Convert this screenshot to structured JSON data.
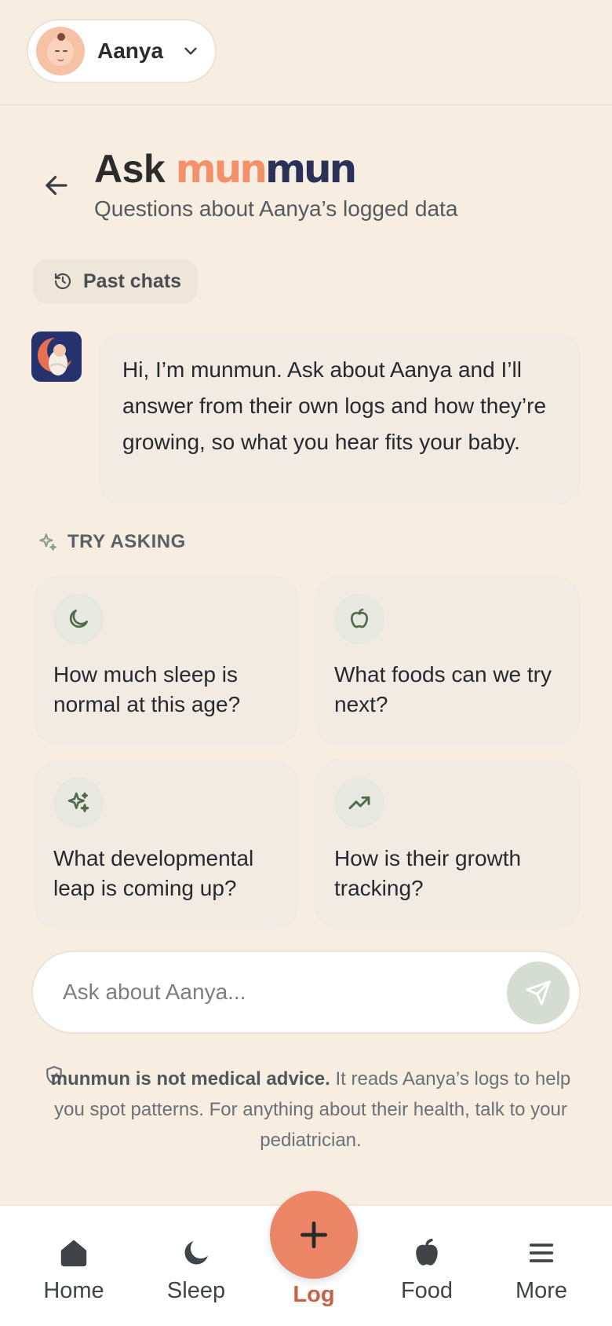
{
  "profile": {
    "name": "Aanya"
  },
  "header": {
    "title_prefix": "Ask",
    "brand_part1": "mun",
    "brand_part2": "mun",
    "subtitle": "Questions about Aanya’s logged data"
  },
  "past_chats_label": "Past chats",
  "bot_message": "Hi, I’m munmun. Ask about Aanya and I’ll answer from their own logs and how they’re growing, so what you hear fits your baby.",
  "try_asking": {
    "label": "TRY ASKING",
    "suggestions": [
      {
        "icon": "moon-icon",
        "text": "How much sleep is normal at this age?"
      },
      {
        "icon": "apple-icon",
        "text": "What foods can we try next?"
      },
      {
        "icon": "sparkles-icon",
        "text": "What developmental leap is coming up?"
      },
      {
        "icon": "trending-up-icon",
        "text": "How is their growth tracking?"
      }
    ]
  },
  "input": {
    "placeholder": "Ask about Aanya..."
  },
  "disclaimer": {
    "bold": "munmun is not medical advice.",
    "text": "It reads Aanya’s logs to help you spot patterns. For anything about their health, talk to your pediatrician."
  },
  "nav": {
    "home": "Home",
    "sleep": "Sleep",
    "log": "Log",
    "food": "Food",
    "more": "More"
  },
  "colors": {
    "background": "#f7ede1",
    "accent": "#ea8666",
    "brand_orange": "#f2916a",
    "brand_navy": "#2a3159",
    "icon_green": "#4e6b4c"
  }
}
